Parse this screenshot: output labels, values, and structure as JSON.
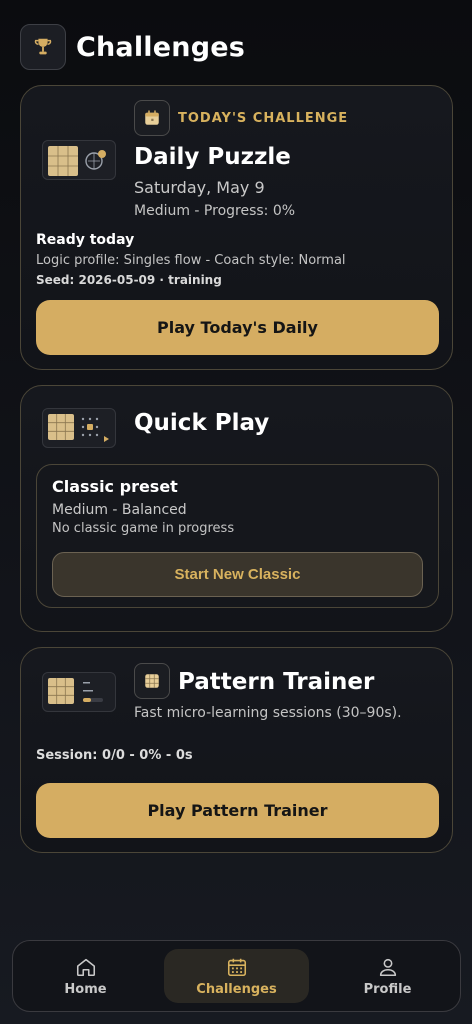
{
  "header": {
    "title": "Challenges",
    "icon": "trophy-icon"
  },
  "daily": {
    "badge": "TODAY'S CHALLENGE",
    "title": "Daily Puzzle",
    "date": "Saturday, May 9",
    "meta": "Medium - Progress: 0%",
    "status": "Ready today",
    "profile": "Logic profile: Singles flow - Coach style: Normal",
    "seed": "Seed: 2026-05-09 · training",
    "button": "Play Today's Daily"
  },
  "quick": {
    "title": "Quick Play",
    "preset_title": "Classic preset",
    "preset_meta": "Medium - Balanced",
    "preset_status": "No classic game in progress",
    "button": "Start New Classic"
  },
  "trainer": {
    "title": "Pattern Trainer",
    "description": "Fast micro-learning sessions (30–90s).",
    "session": "Session: 0/0 - 0% - 0s",
    "button": "Play Pattern Trainer"
  },
  "nav": {
    "items": [
      {
        "label": "Home",
        "icon": "home-icon"
      },
      {
        "label": "Challenges",
        "icon": "calendar-icon",
        "active": true
      },
      {
        "label": "Profile",
        "icon": "user-icon"
      }
    ]
  },
  "colors": {
    "accent": "#d5ad62",
    "background": "#0f1116",
    "card_border": "#4b4638"
  }
}
